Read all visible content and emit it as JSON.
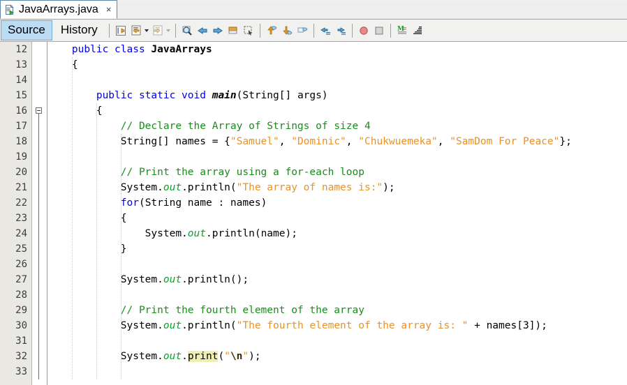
{
  "window": {
    "tab": {
      "title": "JavaArrays.java",
      "icon": "java-file-icon",
      "close_label": "×"
    }
  },
  "view_tabs": [
    {
      "label": "Source",
      "selected": true
    },
    {
      "label": "History",
      "selected": false
    }
  ],
  "toolbar": {
    "groups": [
      {
        "buttons": [
          {
            "name": "last-edit-icon",
            "dropdown": false,
            "disabled": false
          },
          {
            "name": "back-document-icon",
            "dropdown": true,
            "disabled": false
          },
          {
            "name": "forward-document-icon",
            "dropdown": true,
            "disabled": true
          }
        ]
      },
      {
        "buttons": [
          {
            "name": "find-selection-icon",
            "dropdown": false,
            "disabled": false
          },
          {
            "name": "previous-bookmark-icon",
            "dropdown": false,
            "disabled": false
          },
          {
            "name": "next-bookmark-icon",
            "dropdown": false,
            "disabled": false
          },
          {
            "name": "toggle-bookmark-icon",
            "dropdown": false,
            "disabled": false
          },
          {
            "name": "toggle-rectangular-selection-icon",
            "dropdown": false,
            "disabled": false
          }
        ]
      },
      {
        "buttons": [
          {
            "name": "previous-error-icon",
            "dropdown": false,
            "disabled": false
          },
          {
            "name": "next-error-icon",
            "dropdown": false,
            "disabled": false
          },
          {
            "name": "inspect-icon",
            "dropdown": false,
            "disabled": false
          }
        ]
      },
      {
        "buttons": [
          {
            "name": "shift-line-left-icon",
            "dropdown": false,
            "disabled": false
          },
          {
            "name": "shift-line-right-icon",
            "dropdown": false,
            "disabled": false
          }
        ]
      },
      {
        "buttons": [
          {
            "name": "toggle-breakpoint-icon",
            "dropdown": false,
            "disabled": false
          },
          {
            "name": "stop-icon",
            "dropdown": false,
            "disabled": false
          }
        ]
      },
      {
        "buttons": [
          {
            "name": "toggle-highlight-search-icon",
            "dropdown": false,
            "disabled": false
          },
          {
            "name": "toggle-line-numbers-icon",
            "dropdown": false,
            "disabled": false
          }
        ]
      }
    ]
  },
  "editor": {
    "first_line_number": 12,
    "fold_marker_line": 16,
    "lines": [
      {
        "n": 12,
        "tokens": [
          {
            "t": "    ",
            "c": "pln"
          },
          {
            "t": "public class ",
            "c": "kw"
          },
          {
            "t": "JavaArrays",
            "c": "cls"
          }
        ]
      },
      {
        "n": 13,
        "tokens": [
          {
            "t": "    {",
            "c": "pln"
          }
        ]
      },
      {
        "n": 14,
        "tokens": []
      },
      {
        "n": 15,
        "tokens": [
          {
            "t": "        ",
            "c": "pln"
          },
          {
            "t": "public static void ",
            "c": "kw"
          },
          {
            "t": "main",
            "c": "mth"
          },
          {
            "t": "(String[] args)",
            "c": "pln"
          }
        ]
      },
      {
        "n": 16,
        "tokens": [
          {
            "t": "        {",
            "c": "pln"
          }
        ]
      },
      {
        "n": 17,
        "tokens": [
          {
            "t": "            ",
            "c": "pln"
          },
          {
            "t": "// Declare the Array of Strings of size 4",
            "c": "cmt"
          }
        ]
      },
      {
        "n": 18,
        "tokens": [
          {
            "t": "            String[] names = {",
            "c": "pln"
          },
          {
            "t": "\"Samuel\"",
            "c": "str"
          },
          {
            "t": ", ",
            "c": "pln"
          },
          {
            "t": "\"Dominic\"",
            "c": "str"
          },
          {
            "t": ", ",
            "c": "pln"
          },
          {
            "t": "\"Chukwuemeka\"",
            "c": "str"
          },
          {
            "t": ", ",
            "c": "pln"
          },
          {
            "t": "\"SamDom For Peace\"",
            "c": "str"
          },
          {
            "t": "};",
            "c": "pln"
          }
        ]
      },
      {
        "n": 19,
        "tokens": []
      },
      {
        "n": 20,
        "tokens": [
          {
            "t": "            ",
            "c": "pln"
          },
          {
            "t": "// Print the array using a for-each loop",
            "c": "cmt"
          }
        ]
      },
      {
        "n": 21,
        "tokens": [
          {
            "t": "            System.",
            "c": "pln"
          },
          {
            "t": "out",
            "c": "fld"
          },
          {
            "t": ".println(",
            "c": "pln"
          },
          {
            "t": "\"The array of names is:\"",
            "c": "str"
          },
          {
            "t": ");",
            "c": "pln"
          }
        ]
      },
      {
        "n": 22,
        "tokens": [
          {
            "t": "            ",
            "c": "pln"
          },
          {
            "t": "for",
            "c": "kw"
          },
          {
            "t": "(String name : names)",
            "c": "pln"
          }
        ]
      },
      {
        "n": 23,
        "tokens": [
          {
            "t": "            {",
            "c": "pln"
          }
        ]
      },
      {
        "n": 24,
        "tokens": [
          {
            "t": "                System.",
            "c": "pln"
          },
          {
            "t": "out",
            "c": "fld"
          },
          {
            "t": ".println(name);",
            "c": "pln"
          }
        ]
      },
      {
        "n": 25,
        "tokens": [
          {
            "t": "            }",
            "c": "pln"
          }
        ]
      },
      {
        "n": 26,
        "tokens": []
      },
      {
        "n": 27,
        "tokens": [
          {
            "t": "            System.",
            "c": "pln"
          },
          {
            "t": "out",
            "c": "fld"
          },
          {
            "t": ".println();",
            "c": "pln"
          }
        ]
      },
      {
        "n": 28,
        "tokens": []
      },
      {
        "n": 29,
        "tokens": [
          {
            "t": "            ",
            "c": "pln"
          },
          {
            "t": "// Print the fourth element of the array",
            "c": "cmt"
          }
        ]
      },
      {
        "n": 30,
        "tokens": [
          {
            "t": "            System.",
            "c": "pln"
          },
          {
            "t": "out",
            "c": "fld"
          },
          {
            "t": ".println(",
            "c": "pln"
          },
          {
            "t": "\"The fourth element of the array is: \"",
            "c": "str"
          },
          {
            "t": " + names[3]);",
            "c": "pln"
          }
        ]
      },
      {
        "n": 31,
        "tokens": []
      },
      {
        "n": 32,
        "tokens": [
          {
            "t": "            System.",
            "c": "pln"
          },
          {
            "t": "out",
            "c": "fld"
          },
          {
            "t": ".",
            "c": "pln"
          },
          {
            "t": "print",
            "c": "pln hl"
          },
          {
            "t": "(",
            "c": "pln"
          },
          {
            "t": "\"",
            "c": "str"
          },
          {
            "t": "\\n",
            "c": "esc"
          },
          {
            "t": "\"",
            "c": "str"
          },
          {
            "t": ");",
            "c": "pln"
          }
        ]
      },
      {
        "n": 33,
        "tokens": []
      }
    ]
  },
  "colors": {
    "keyword": "#0000e6",
    "string": "#e8912a",
    "comment": "#1a8c1a",
    "field": "#0f9e2f",
    "highlight": "#efefb3",
    "gutter_bg": "#e9e8e2",
    "toolbar_bg": "#f1f1f0",
    "selected_tab_bg": "#bcdcf4"
  }
}
